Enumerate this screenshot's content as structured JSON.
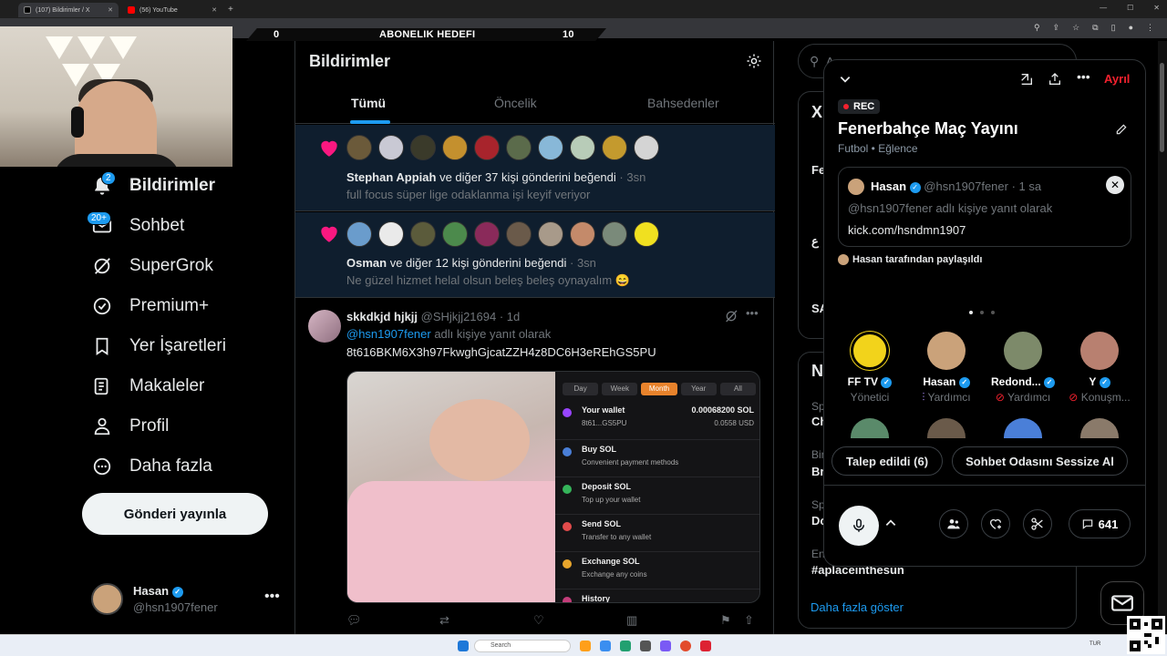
{
  "browser": {
    "tabs": [
      {
        "title": "(107) Bildirimler / X"
      },
      {
        "title": "(56) YouTube"
      }
    ]
  },
  "overlay": {
    "left_count": "0",
    "goal_label": "ABONELIK HEDEFI",
    "right_count": "10"
  },
  "nav": {
    "items": [
      {
        "label": "Bildirimler",
        "icon": "bell-icon",
        "badge": "2"
      },
      {
        "label": "Sohbet",
        "icon": "mail-icon",
        "badge": "20+"
      },
      {
        "label": "SuperGrok",
        "icon": "grok-icon"
      },
      {
        "label": "Premium+",
        "icon": "verified-icon"
      },
      {
        "label": "Yer İşaretleri",
        "icon": "bookmark-icon"
      },
      {
        "label": "Makaleler",
        "icon": "article-icon"
      },
      {
        "label": "Profil",
        "icon": "person-icon"
      },
      {
        "label": "Daha fazla",
        "icon": "more-circle-icon"
      }
    ],
    "post_button": "Gönderi yayınla",
    "account": {
      "name": "Hasan",
      "handle": "@hsn1907fener"
    }
  },
  "notifications": {
    "title": "Bildirimler",
    "tabs": [
      "Tümü",
      "Öncelik",
      "Bahsedenler"
    ],
    "items": [
      {
        "actor": "Stephan Appiah",
        "action": " ve diğer 37 kişi gönderini beğendi",
        "time": " · 3sn",
        "snippet": "full focus süper lige odaklanma işi keyif veriyor"
      },
      {
        "actor": "Osman",
        "action": " ve diğer 12 kişi gönderini beğendi",
        "time": " · 3sn",
        "snippet": "Ne güzel hizmet helal olsun beleş beleş oynayalım 😄"
      }
    ],
    "tweet": {
      "name": "skkdkjd hjkjj",
      "handle": " @SHjkjj21694 · 1d",
      "reply_to": "@hsn1907fener",
      "reply_suffix": " adlı kişiye yanıt olarak",
      "body": "8t616BKM6X3h97FkwghGjcatZZH4z8DC6H3eREhGS5PU",
      "wallet": {
        "segments": [
          "Day",
          "Week",
          "Month",
          "Year",
          "All"
        ],
        "active_segment": "Month",
        "title": "Your wallet",
        "address": "8t61...GS5PU",
        "balance": "0.00068200 SOL",
        "usd": "0.0558 USD",
        "rows": [
          {
            "title": "Buy SOL",
            "sub": "Convenient payment methods",
            "color": "#4a7fd8"
          },
          {
            "title": "Deposit SOL",
            "sub": "Top up your wallet",
            "color": "#35b45a"
          },
          {
            "title": "Send SOL",
            "sub": "Transfer to any wallet",
            "color": "#e24b4b"
          },
          {
            "title": "Exchange SOL",
            "sub": "Exchange any coins",
            "color": "#e8a52c"
          },
          {
            "title": "History",
            "sub": "",
            "color": "#c43d7a"
          }
        ]
      }
    }
  },
  "right": {
    "search_placeholder": "A",
    "trends_title_fragment": "X",
    "news_title_fragment": "No",
    "trend_rows": [
      {
        "cat": "Spo",
        "name": "Ch"
      },
      {
        "cat": "Birl",
        "name": "Bro"
      },
      {
        "cat": "Spo",
        "name": "Do"
      },
      {
        "cat": "Eng",
        "name": "#aplaceinthesun"
      }
    ],
    "card1_rows": [
      "Fe",
      "ع",
      "SA"
    ],
    "show_more": "Daha fazla göster"
  },
  "space": {
    "leave": "Ayrıl",
    "rec": "REC",
    "title": "Fenerbahçe Maç Yayını",
    "subtitle": "Futbol • Eğlence",
    "pinned": {
      "name": "Hasan",
      "handle": " @hsn1907fener · 1 sa",
      "reply": "@hsn1907fener adlı kişiye yanıt olarak",
      "link": "kick.com/hsndmn1907"
    },
    "shared_by": "Hasan tarafından paylaşıldı",
    "speakers": [
      {
        "name": "FF TV",
        "role": "Yönetici",
        "color": "#f2d31b"
      },
      {
        "name": "Hasan",
        "role": "Yardımcı",
        "color": "#caa27a"
      },
      {
        "name": "Redond...",
        "role": "Yardımcı",
        "color": "#7d8a6a"
      },
      {
        "name": "Y",
        "role": "Konuşm...",
        "color": "#b88070"
      }
    ],
    "request_button": "Talep edildi (6)",
    "mute_button": "Sohbet Odasını Sessize Al",
    "comment_count": "641"
  },
  "taskbar": {
    "search": "Search",
    "lang": "TUR"
  },
  "colors": {
    "accent": "#1d9bf0",
    "like": "#f91880",
    "rec": "#f4212e",
    "leave": "#f4212e"
  }
}
